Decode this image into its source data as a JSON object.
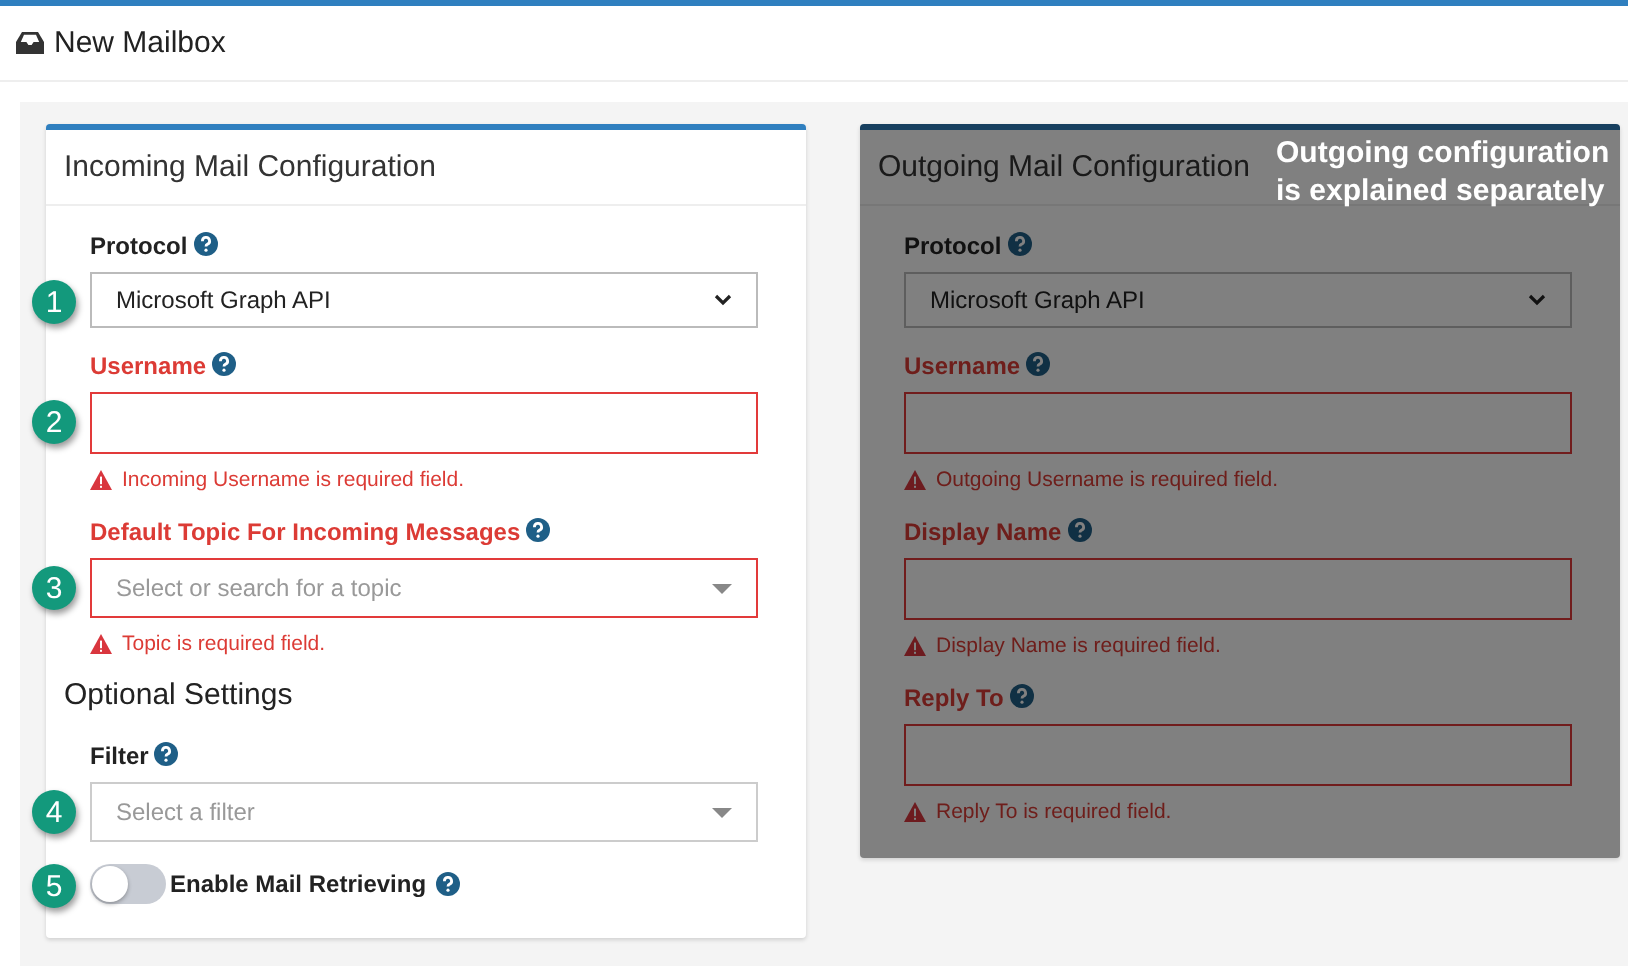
{
  "page": {
    "title": "New Mailbox"
  },
  "incoming": {
    "title": "Incoming Mail Configuration",
    "dimmed": false,
    "fields": [
      {
        "kind": "select",
        "label": "Protocol",
        "badge": "1",
        "value": "Microsoft Graph API",
        "invalid": false
      },
      {
        "kind": "text",
        "label": "Username",
        "badge": "2",
        "invalid": true,
        "error": "Incoming Username is required field."
      },
      {
        "kind": "combo",
        "label": "Default Topic For Incoming Messages",
        "badge": "3",
        "placeholder": "Select or search for a topic",
        "invalid": true,
        "error": "Topic is required field."
      }
    ],
    "optional_title": "Optional Settings",
    "optional_fields": [
      {
        "kind": "combo",
        "label": "Filter",
        "badge": "4",
        "placeholder": "Select a filter",
        "invalid": false
      },
      {
        "kind": "toggle",
        "label": "Enable Mail Retrieving",
        "badge": "5",
        "on": false
      }
    ]
  },
  "outgoing": {
    "title": "Outgoing Mail Configuration",
    "dimmed": true,
    "note": "Outgoing configuration is explained separately",
    "fields": [
      {
        "kind": "select",
        "label": "Protocol",
        "value": "Microsoft Graph API",
        "invalid": false
      },
      {
        "kind": "text",
        "label": "Username",
        "invalid": true,
        "error": "Outgoing Username is required field."
      },
      {
        "kind": "text",
        "label": "Display Name",
        "invalid": true,
        "error": "Display Name is required field."
      },
      {
        "kind": "text",
        "label": "Reply To",
        "invalid": true,
        "error": "Reply To is required field."
      }
    ]
  }
}
